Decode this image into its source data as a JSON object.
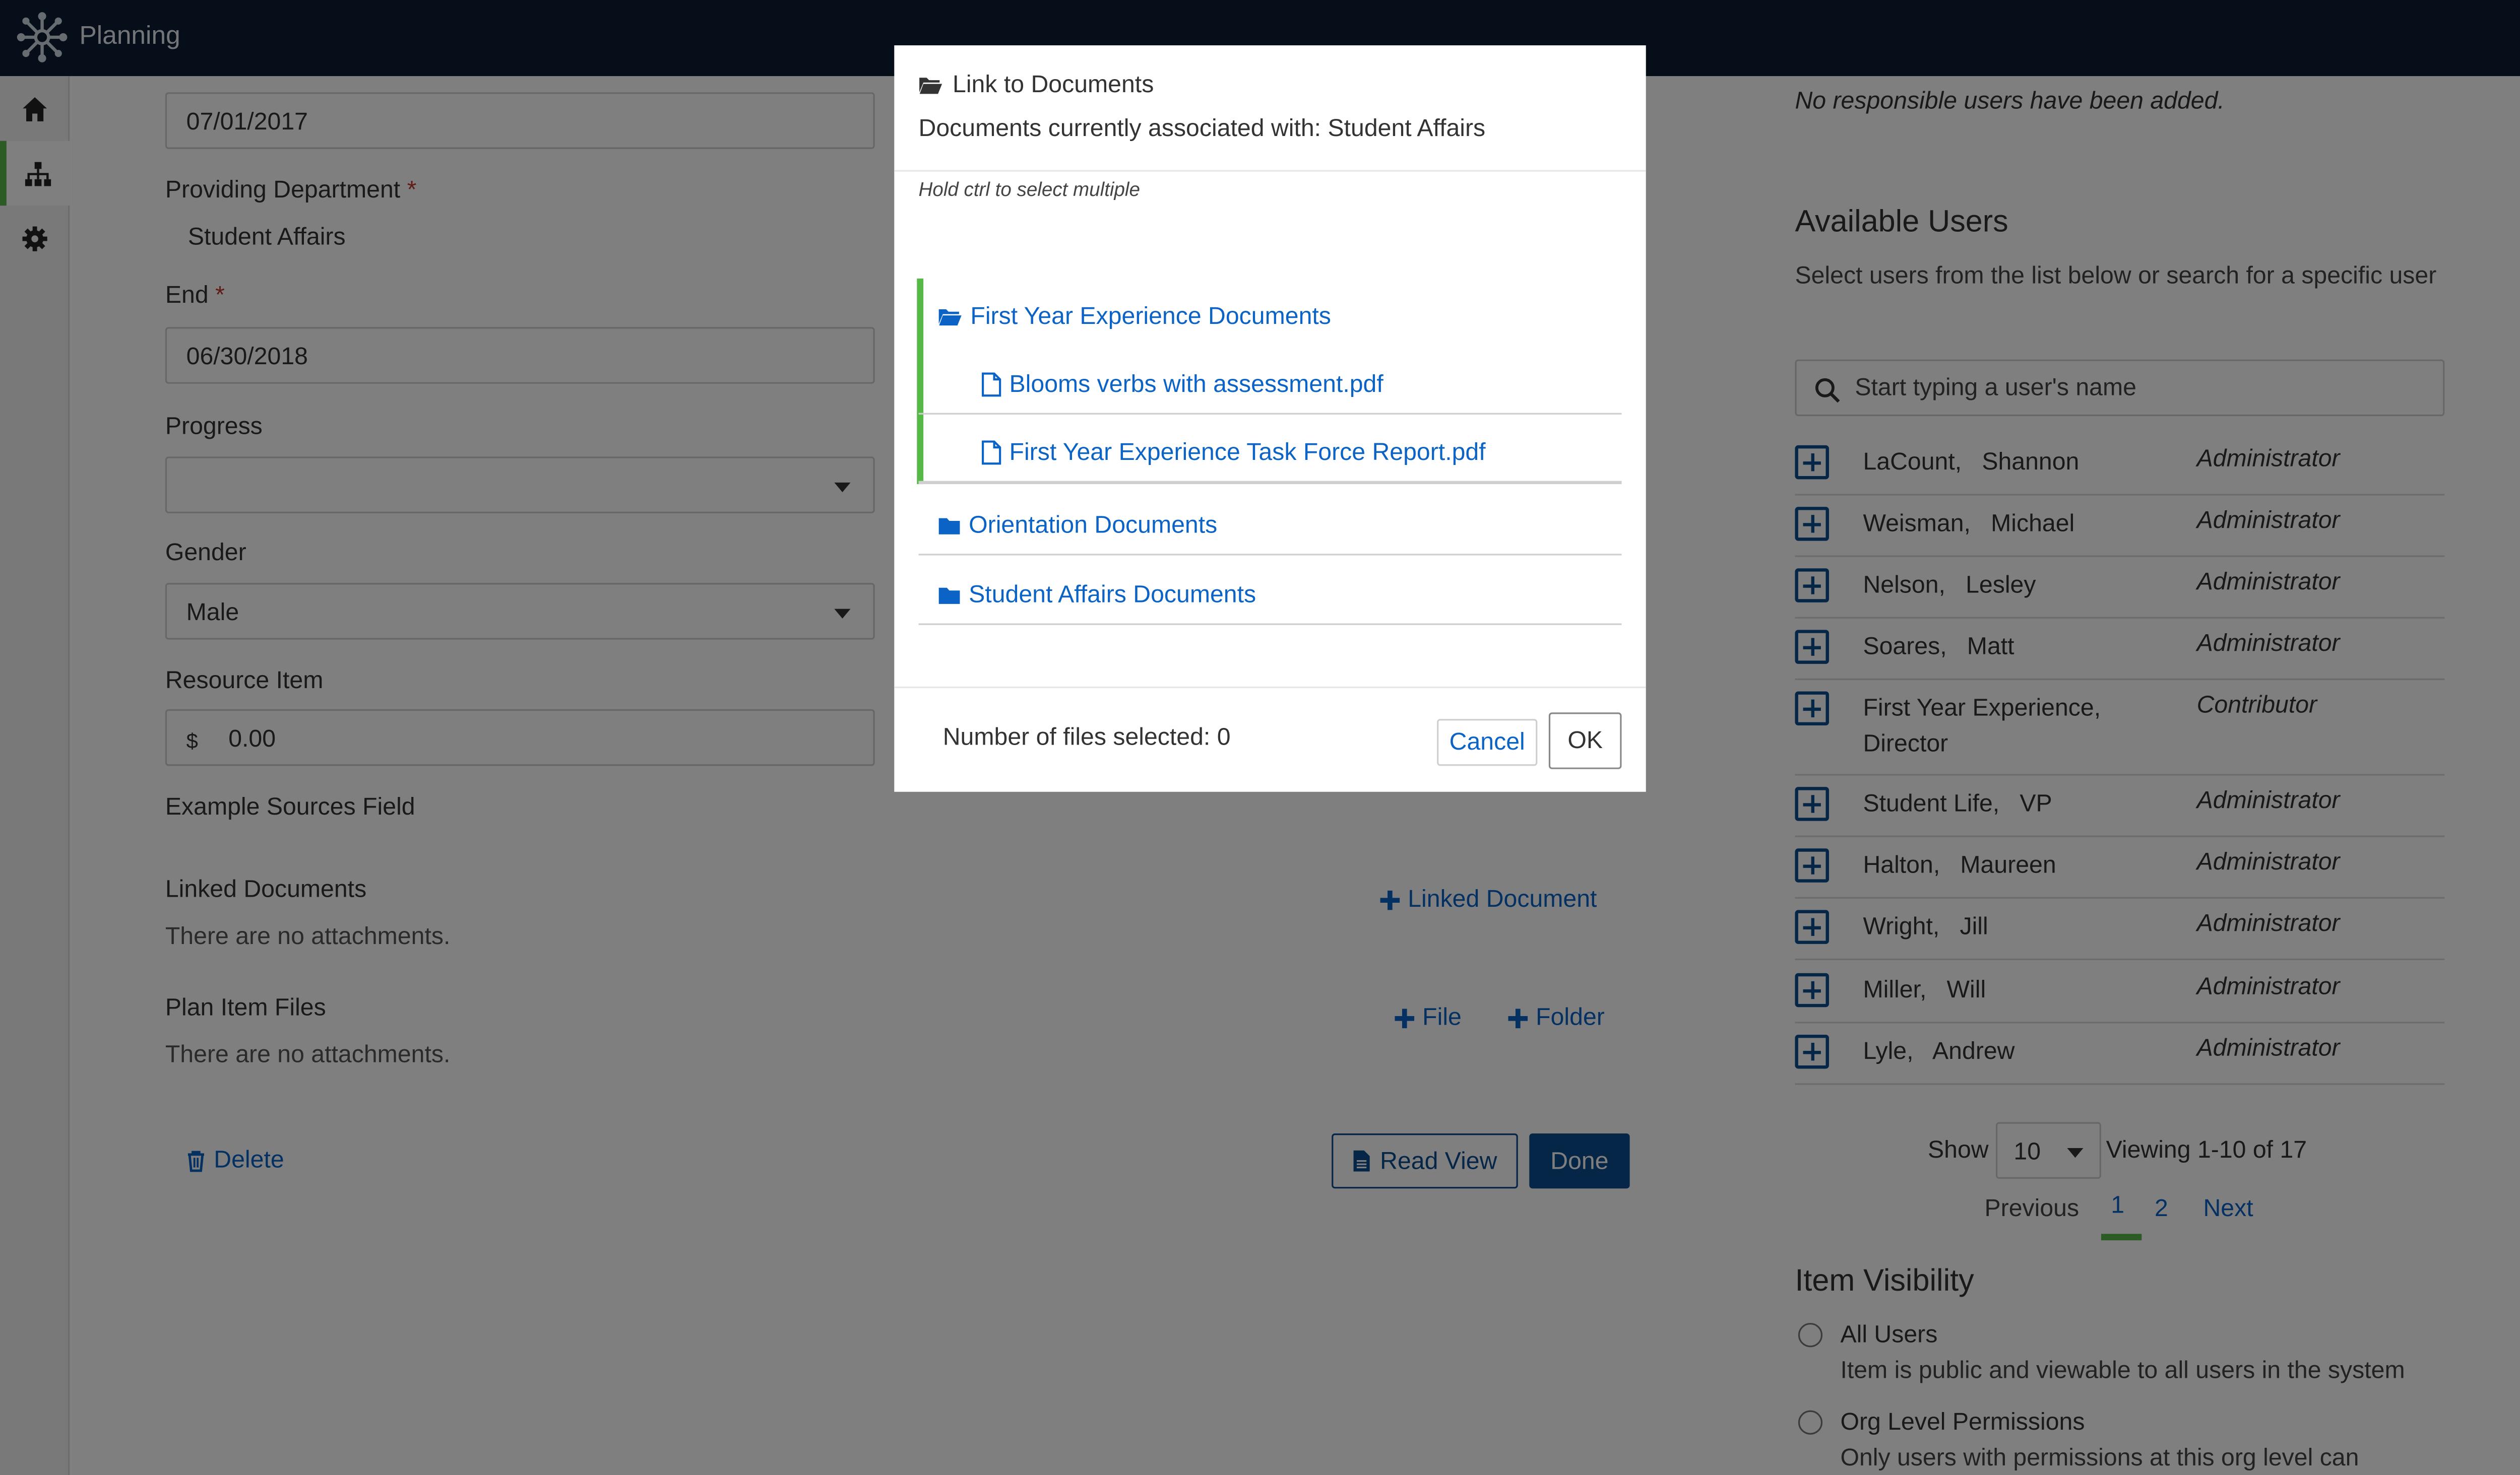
{
  "app": {
    "title": "Planning",
    "logo_icon": "network-logo-icon"
  },
  "rail": [
    {
      "icon": "home-icon",
      "active": false
    },
    {
      "icon": "sitemap-icon",
      "active": true
    },
    {
      "icon": "gear-icon",
      "active": false
    }
  ],
  "form": {
    "start_value": "07/01/2017",
    "providing_department_label": "Providing Department",
    "required_mark": "*",
    "providing_department_value": "Student Affairs",
    "end_label": "End",
    "end_value": "06/30/2018",
    "progress_label": "Progress",
    "progress_value": "",
    "gender_label": "Gender",
    "gender_value": "Male",
    "resource_label": "Resource Item",
    "resource_prefix": "$",
    "resource_value": "0.00",
    "example_sources_label": "Example Sources Field",
    "linked_documents_label": "Linked Documents",
    "linked_documents_empty": "There are no attachments.",
    "linked_document_button": "Linked Document",
    "plan_item_files_label": "Plan Item Files",
    "plan_item_files_empty": "There are no attachments.",
    "file_button": "File",
    "folder_button": "Folder",
    "delete_button": "Delete",
    "read_view_button": "Read View",
    "done_button": "Done"
  },
  "right_panel": {
    "no_responsible": "No responsible users have been added.",
    "available_users_heading": "Available Users",
    "available_users_desc": "Select users from the list below or search for a specific user",
    "search_placeholder": "Start typing a user's name",
    "users": [
      {
        "name": "LaCount,   Shannon",
        "role": "Administrator"
      },
      {
        "name": "Weisman,   Michael",
        "role": "Administrator"
      },
      {
        "name": "Nelson,   Lesley",
        "role": "Administrator"
      },
      {
        "name": "Soares,   Matt",
        "role": "Administrator"
      },
      {
        "name": "First Year Experience,   Director",
        "role": "Contributor"
      },
      {
        "name": "Student Life,   VP",
        "role": "Administrator"
      },
      {
        "name": "Halton,   Maureen",
        "role": "Administrator"
      },
      {
        "name": "Wright,   Jill",
        "role": "Administrator"
      },
      {
        "name": "Miller,   Will",
        "role": "Administrator"
      },
      {
        "name": "Lyle,   Andrew",
        "role": "Administrator"
      }
    ],
    "pager": {
      "show_label": "Show",
      "page_size": "10",
      "viewing": "Viewing 1-10 of 17",
      "previous": "Previous",
      "pages": [
        "1",
        "2"
      ],
      "current_page": "1",
      "next": "Next"
    },
    "visibility_heading": "Item Visibility",
    "visibility_options": [
      {
        "title": "All Users",
        "desc": "Item is public and viewable to all users in the system"
      },
      {
        "title": "Org Level Permissions",
        "desc": "Only users with permissions at this org level can"
      }
    ]
  },
  "modal": {
    "title": "Link to Documents",
    "subtitle": "Documents currently associated with: Student Affairs",
    "hint": "Hold ctrl to select multiple",
    "tree": [
      {
        "type": "folder-open",
        "label": "First Year Experience Documents",
        "children": [
          "Blooms verbs with assessment.pdf",
          "First Year Experience Task Force Report.pdf"
        ]
      },
      {
        "type": "folder",
        "label": "Orientation Documents"
      },
      {
        "type": "folder",
        "label": "Student Affairs Documents"
      }
    ],
    "selected_count_text": "Number of files selected: 0",
    "cancel_button": "Cancel",
    "ok_button": "OK"
  },
  "colors": {
    "topbar": "#0c1e33",
    "link": "#0b63c5",
    "primary": "#0b4c8c",
    "accent_green": "#56b947"
  }
}
